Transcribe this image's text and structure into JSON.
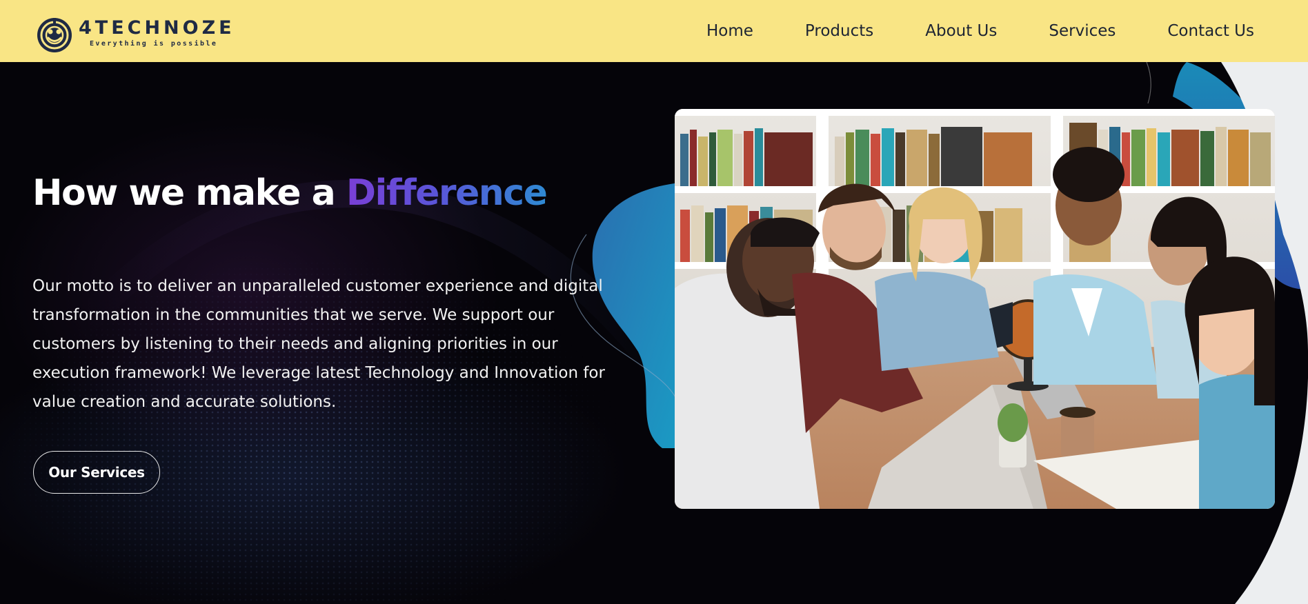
{
  "brand": {
    "name": "4TECHNOZE",
    "tagline": "Everything is possible",
    "logo_icon": "technoze-logo-icon"
  },
  "nav": {
    "items": [
      {
        "label": "Home"
      },
      {
        "label": "Products"
      },
      {
        "label": "About Us"
      },
      {
        "label": "Services"
      },
      {
        "label": "Contact Us"
      }
    ]
  },
  "hero": {
    "headline_prefix": "How we make a ",
    "headline_accent": "Difference",
    "paragraph_lines": [
      "Our motto is to deliver an unparalleled customer experience and digital",
      "transformation in the communities that we serve. We support our",
      "customers by listening to their needs and aligning priorities in our",
      "execution framework! We leverage latest Technology and Innovation for",
      "value creation and accurate solutions."
    ],
    "button_label": "Our Services",
    "image_icon": "students-studying-photo"
  },
  "colors": {
    "nav_background": "#f9e585",
    "nav_text": "#1d2433",
    "brand_dark": "#1f2a44",
    "accent_purple": "#7a3fd6",
    "accent_blue": "#2f8ad3",
    "hero_background": "#050409",
    "shape_teal": "#1a8bb8"
  }
}
